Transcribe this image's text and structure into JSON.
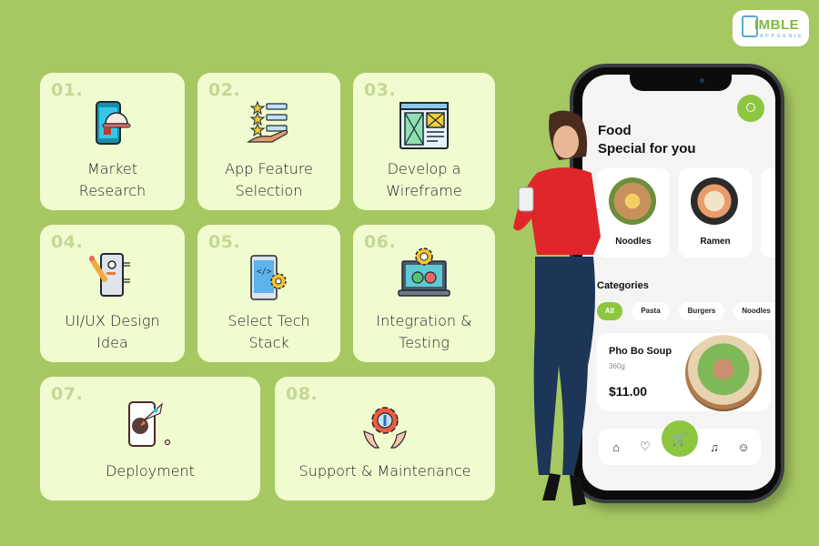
{
  "brand": {
    "logo_word": "IMBLE",
    "logo_initial": "N",
    "logo_sub": "APPGENIE"
  },
  "steps": [
    {
      "number": "01.",
      "label_line1": "Market",
      "label_line2": "Research",
      "icon": "food-service-phone-icon"
    },
    {
      "number": "02.",
      "label_line1": "App Feature",
      "label_line2": "Selection",
      "icon": "rated-list-hand-icon"
    },
    {
      "number": "03.",
      "label_line1": "Develop a",
      "label_line2": "Wireframe",
      "icon": "wireframe-window-icon"
    },
    {
      "number": "04.",
      "label_line1": "UI/UX Design",
      "label_line2": "Idea",
      "icon": "design-pencil-phone-icon"
    },
    {
      "number": "05.",
      "label_line1": "Select Tech",
      "label_line2": "Stack",
      "icon": "code-gear-phone-icon"
    },
    {
      "number": "06.",
      "label_line1": "Integration &",
      "label_line2": "Testing",
      "icon": "laptop-gear-check-icon"
    },
    {
      "number": "07.",
      "label_line1": "Deployment",
      "label_line2": "",
      "icon": "rocket-phone-icon"
    },
    {
      "number": "08.",
      "label_line1": "Support & Maintenance",
      "label_line2": "",
      "icon": "gear-wrench-hands-icon"
    }
  ],
  "phone_app": {
    "title_line1": "Food",
    "title_line2": "Special for you",
    "featured": [
      {
        "name": "Noodles"
      },
      {
        "name": "Ramen"
      }
    ],
    "categories_title": "Categories",
    "categories": [
      "All",
      "Pasta",
      "Burgers",
      "Noodles"
    ],
    "active_category": "All",
    "dish": {
      "name": "Pho Bo Soup",
      "weight": "360g",
      "price": "$11.00"
    },
    "tabs": [
      "home",
      "favorites",
      "cart",
      "notifications",
      "profile"
    ],
    "accent_color": "#8dc63f"
  },
  "colors": {
    "background": "#a6c862",
    "card": "#f0fbd0",
    "number": "#c3d896"
  }
}
